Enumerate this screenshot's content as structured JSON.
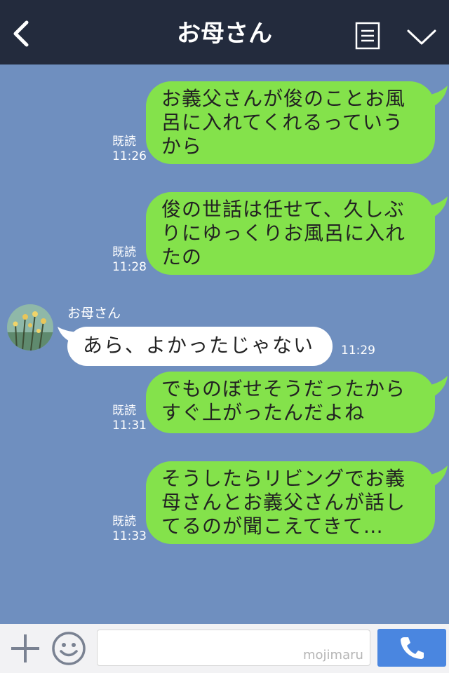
{
  "header": {
    "title": "お母さん",
    "back_icon": "chevron-left-icon",
    "menu_icon": "list-icon",
    "collapse_icon": "chevron-down-icon"
  },
  "messages": [
    {
      "direction": "sent",
      "text": "お義父さんが俊のことお風\n呂に入れてくれるっていう\nから",
      "read_label": "既読",
      "time": "11:26"
    },
    {
      "direction": "sent",
      "text": "俊の世話は任せて、久しぶ\nりにゆっくりお風呂に入れ\nたの",
      "read_label": "既読",
      "time": "11:28"
    },
    {
      "direction": "received",
      "sender": "お母さん",
      "text": "あら、よかったじゃない",
      "time": "11:29"
    },
    {
      "direction": "sent",
      "text": "でものぼせそうだったから\nすぐ上がったんだよね",
      "read_label": "既読",
      "time": "11:31"
    },
    {
      "direction": "sent",
      "text": "そうしたらリビングでお義\n母さんとお義父さんが話し\nてるのが聞こえてきて…",
      "read_label": "既読",
      "time": "11:33"
    }
  ],
  "input_bar": {
    "plus_icon": "plus-icon",
    "emoji_icon": "smiley-icon",
    "input_value": "",
    "watermark": "mojimaru",
    "call_icon": "phone-icon"
  },
  "colors": {
    "header_bg": "#232b3d",
    "chat_bg": "#6f8fbf",
    "sent_bubble": "#84e24b",
    "received_bubble": "#ffffff",
    "call_button": "#4a86e0"
  }
}
